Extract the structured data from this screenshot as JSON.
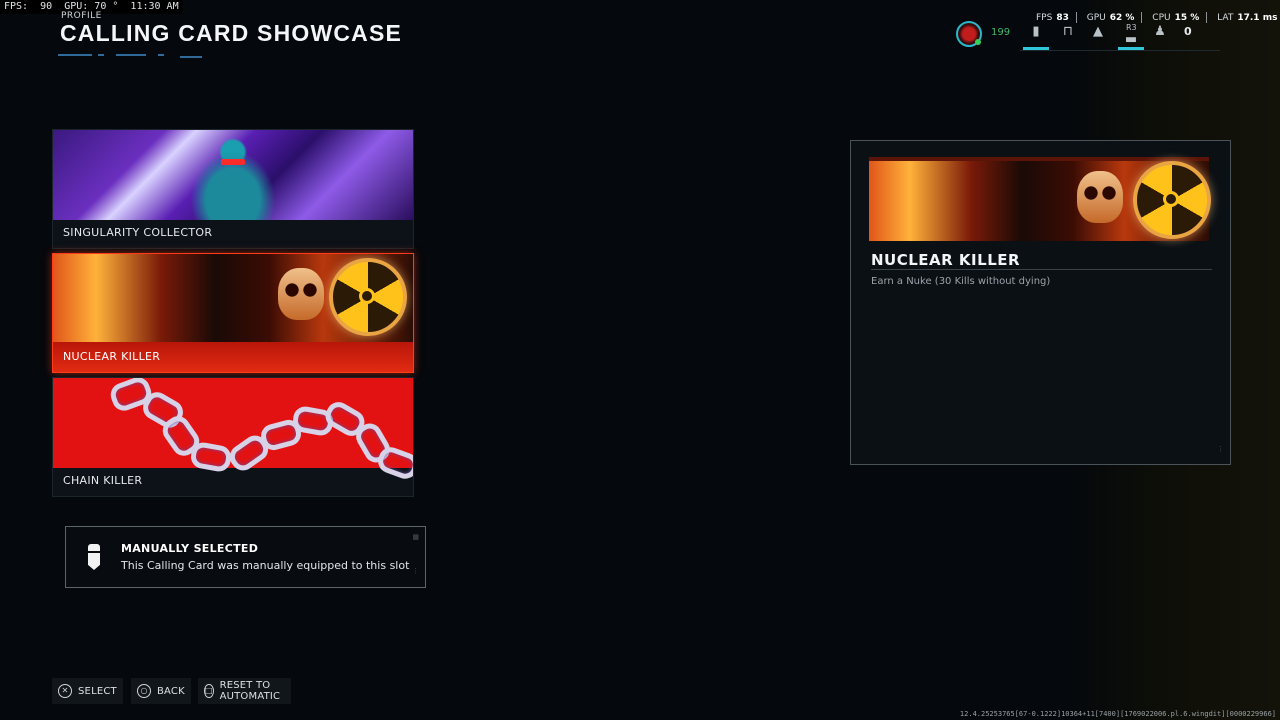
{
  "overlay": {
    "text": "FPS:  90  GPU: 70 °  11:30 AM"
  },
  "header": {
    "profile_label": "PROFILE",
    "title": "CALLING CARD SHOWCASE"
  },
  "hud": {
    "level": "199",
    "r3_label": "R3",
    "count": "0",
    "stats": {
      "fps_label": "FPS",
      "fps": "83",
      "gpu_label": "GPU",
      "gpu": "62 %",
      "cpu_label": "CPU",
      "cpu": "15 %",
      "lat_label": "LAT",
      "lat": "17.1 ms"
    }
  },
  "cards": [
    {
      "label": "SINGULARITY COLLECTOR",
      "selected": false
    },
    {
      "label": "NUCLEAR KILLER",
      "selected": true
    },
    {
      "label": "CHAIN KILLER",
      "selected": false
    }
  ],
  "info": {
    "title": "MANUALLY SELECTED",
    "text": "This Calling Card was manually equipped to this slot"
  },
  "detail": {
    "title": "NUCLEAR KILLER",
    "description": "Earn a Nuke (30 Kills without dying)"
  },
  "prompts": [
    {
      "icon": "cross-button-icon",
      "glyph": "✕",
      "label": "SELECT"
    },
    {
      "icon": "circle-button-icon",
      "glyph": "○",
      "label": "BACK"
    },
    {
      "icon": "square-button-icon",
      "glyph": "□",
      "label": "RESET TO AUTOMATIC"
    }
  ],
  "build_string": "12.4.25253765[67-0.1222]10364+11[7400][1769022006.pl.6.wingdit][0000229966]",
  "colors": {
    "selected": "#e22b12",
    "accent": "#2fc7d9",
    "background": "#05080c"
  }
}
